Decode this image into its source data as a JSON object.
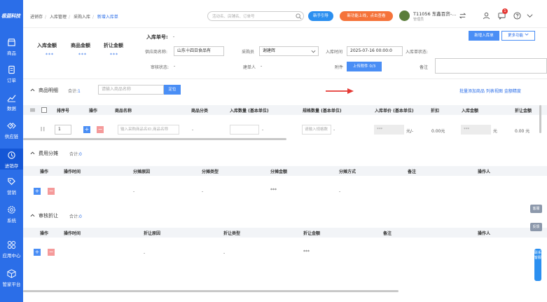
{
  "brand": {
    "logo": "极蓝科技"
  },
  "sidebar": {
    "items": [
      {
        "label": "商品",
        "icon": "store-icon"
      },
      {
        "label": "订单",
        "icon": "order-icon"
      },
      {
        "label": "数据",
        "icon": "chart-icon"
      },
      {
        "label": "供应链",
        "icon": "supply-chain-icon"
      },
      {
        "label": "进销存",
        "icon": "inventory-icon",
        "active": true
      },
      {
        "label": "营销",
        "icon": "tag-icon"
      },
      {
        "label": "系统",
        "icon": "settings-icon"
      },
      {
        "label": "应用中心",
        "icon": "apps-icon"
      },
      {
        "label": "管家平台",
        "icon": "cube-icon"
      }
    ]
  },
  "breadcrumb": {
    "items": [
      "进销存",
      "入库管理",
      "采购入库"
    ],
    "current": "新增入库单"
  },
  "header": {
    "search_placeholder": "活动名、店铺名、订单号",
    "btn_new_guide": "新手引导",
    "btn_promo": "新功能上线，点击查看",
    "user_name": "T11056 东鑫百货-...",
    "user_sub": "管理员",
    "notif_count": "1"
  },
  "summary": {
    "items": [
      {
        "label": "入库金额",
        "value": "***"
      },
      {
        "label": "商品金额",
        "value": "***"
      },
      {
        "label": "折让金额",
        "value": "***"
      }
    ]
  },
  "form": {
    "order_no_label": "入库单号:",
    "order_no_value": "-",
    "supplier_label": "供应商名称:",
    "supplier_value": "山东十四日食品有",
    "buyer_label": "采购员",
    "buyer_value": "谢建辉",
    "time_label": "入库时间",
    "time_value": "2025-07-16 00:00:0",
    "status_label": "入库单状态:",
    "review_label": "审核状态:",
    "review_value": "-",
    "creator_label": "建单人",
    "creator_value": "-",
    "attach_label": "附件",
    "attach_btn": "上传附件 0/3",
    "remark_label": "备注",
    "btn_save": "新增入库单",
    "btn_more": "更多功能"
  },
  "goods": {
    "title": "商品明细",
    "total_label": "合计:",
    "total_value": "1",
    "search_placeholder": "请输入商品名称",
    "search_btn": "定位",
    "right_links": "批量添加商品 列表视图 金额精度",
    "columns": [
      "排序号",
      "操作",
      "商品名称",
      "商品分类",
      "入库数量 (基本单位)",
      "规格数量 (基本单位)",
      "入库单价 (基本单位)",
      "折扣",
      "入库金额",
      "折让金额"
    ],
    "row": {
      "idx": "1",
      "name_placeholder": "输入采购商品名ID,商品名称",
      "category": "-",
      "qty_unit": "-",
      "spec_placeholder": "请输入规格数",
      "spec_unit": "-",
      "price": "***",
      "price_unit": "元/-",
      "discount": "0.00元",
      "amount": "***",
      "amount_unit": "元",
      "allow": "0.00 元"
    }
  },
  "fees": {
    "title": "费用分摊",
    "total_label": "合计:",
    "total_value": "0",
    "columns": [
      "操作",
      "操作时间",
      "分摊原因",
      "分摊类型",
      "分摊金额",
      "分摊方式",
      "备注",
      "操作人"
    ],
    "row": {
      "reason": "-",
      "type": "-",
      "amount": "***",
      "method": "-"
    }
  },
  "audit": {
    "title": "审核折让",
    "total_label": "合计:",
    "total_value": "0",
    "columns": [
      "操作",
      "操作时间",
      "折让原因",
      "折让类型",
      "折让金额",
      "备注",
      "操作人"
    ],
    "row": {
      "reason": "-",
      "type": "-",
      "amount": "***"
    }
  },
  "side_tabs": {
    "tab1": "客服",
    "tab2": "反馈",
    "help": "联系客服"
  }
}
